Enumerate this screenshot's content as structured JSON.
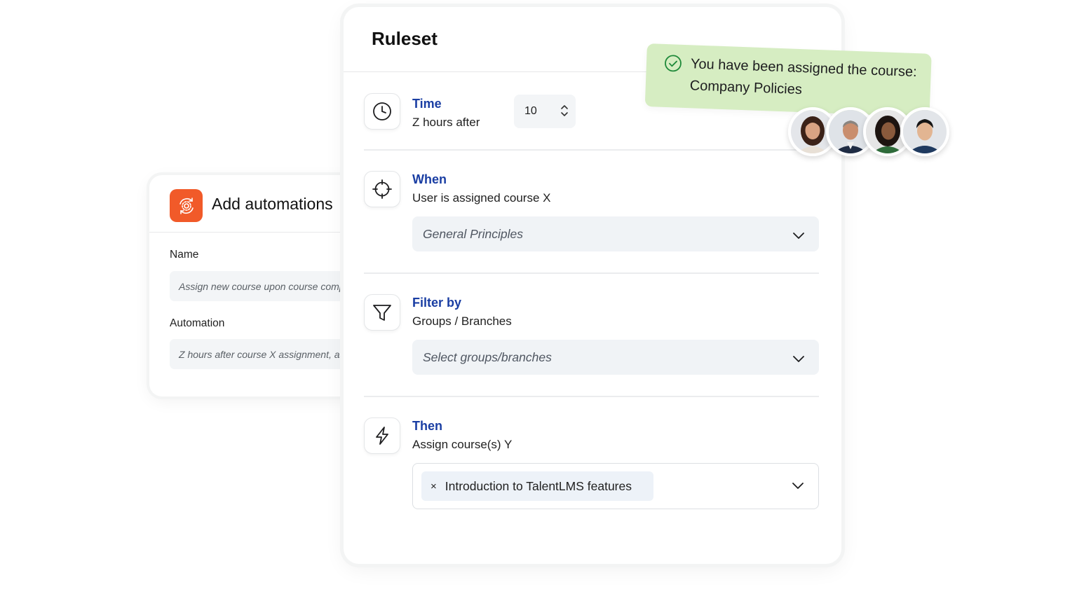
{
  "automation": {
    "title": "Add automations",
    "name_label": "Name",
    "name_value": "Assign new course upon course completion",
    "automation_label": "Automation",
    "automation_value": "Z hours after course X assignment, assign course Y",
    "logo_icon": "gear-sync-icon",
    "brand_color": "#f15a29"
  },
  "ruleset": {
    "title": "Ruleset",
    "time": {
      "title": "Time",
      "subtitle": "Z hours after",
      "value": "10",
      "icon": "clock-icon"
    },
    "when": {
      "title": "When",
      "subtitle": "User is assigned course X",
      "select_value": "General Principles",
      "icon": "crosshair-icon"
    },
    "filter": {
      "title": "Filter by",
      "subtitle": "Groups / Branches",
      "select_placeholder": "Select groups/branches",
      "icon": "funnel-icon"
    },
    "then": {
      "title": "Then",
      "subtitle": "Assign course(s) Y",
      "chip_label": "Introduction to TalentLMS features",
      "chip_remove": "×",
      "icon": "lightning-icon"
    },
    "accent_color": "#1a3ea3"
  },
  "notification": {
    "line1": "You have been assigned the course:",
    "line2": "Company Policies",
    "icon": "check-circle-icon",
    "bg_color": "#d6edc2"
  },
  "avatars": [
    "avatar-woman-1",
    "avatar-man-1",
    "avatar-woman-2",
    "avatar-man-2"
  ]
}
